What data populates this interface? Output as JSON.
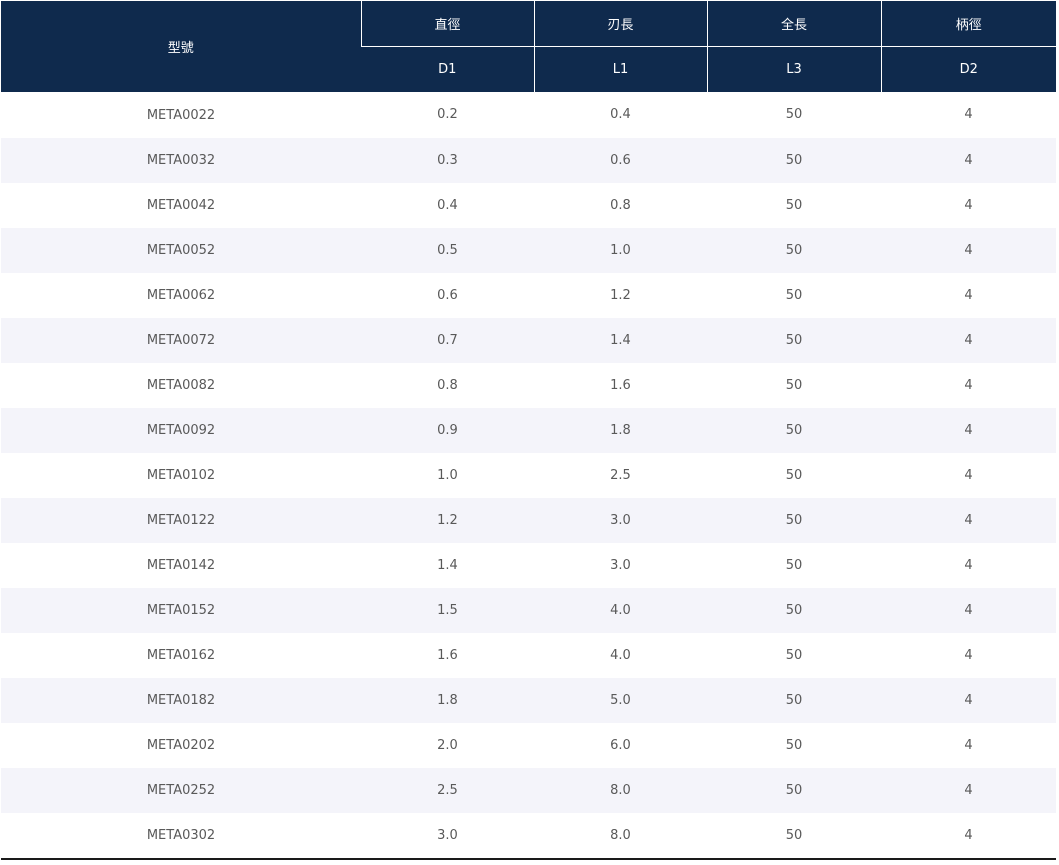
{
  "table": {
    "headers": {
      "model": "型號",
      "diameter": "直徑",
      "flute_length": "刃長",
      "overall_length": "全長",
      "shank_diameter": "柄徑"
    },
    "subheaders": {
      "diameter": "D1",
      "flute_length": "L1",
      "overall_length": "L3",
      "shank_diameter": "D2"
    },
    "rows": [
      [
        "META0022",
        "0.2",
        "0.4",
        "50",
        "4"
      ],
      [
        "META0032",
        "0.3",
        "0.6",
        "50",
        "4"
      ],
      [
        "META0042",
        "0.4",
        "0.8",
        "50",
        "4"
      ],
      [
        "META0052",
        "0.5",
        "1.0",
        "50",
        "4"
      ],
      [
        "META0062",
        "0.6",
        "1.2",
        "50",
        "4"
      ],
      [
        "META0072",
        "0.7",
        "1.4",
        "50",
        "4"
      ],
      [
        "META0082",
        "0.8",
        "1.6",
        "50",
        "4"
      ],
      [
        "META0092",
        "0.9",
        "1.8",
        "50",
        "4"
      ],
      [
        "META0102",
        "1.0",
        "2.5",
        "50",
        "4"
      ],
      [
        "META0122",
        "1.2",
        "3.0",
        "50",
        "4"
      ],
      [
        "META0142",
        "1.4",
        "3.0",
        "50",
        "4"
      ],
      [
        "META0152",
        "1.5",
        "4.0",
        "50",
        "4"
      ],
      [
        "META0162",
        "1.6",
        "4.0",
        "50",
        "4"
      ],
      [
        "META0182",
        "1.8",
        "5.0",
        "50",
        "4"
      ],
      [
        "META0202",
        "2.0",
        "6.0",
        "50",
        "4"
      ],
      [
        "META0252",
        "2.5",
        "8.0",
        "50",
        "4"
      ],
      [
        "META0302",
        "3.0",
        "8.0",
        "50",
        "4"
      ]
    ]
  },
  "colors": {
    "header_background": "#0f2a4d",
    "header_text": "#ffffff",
    "stripe_background": "#f4f4fa",
    "body_text": "#595959"
  }
}
